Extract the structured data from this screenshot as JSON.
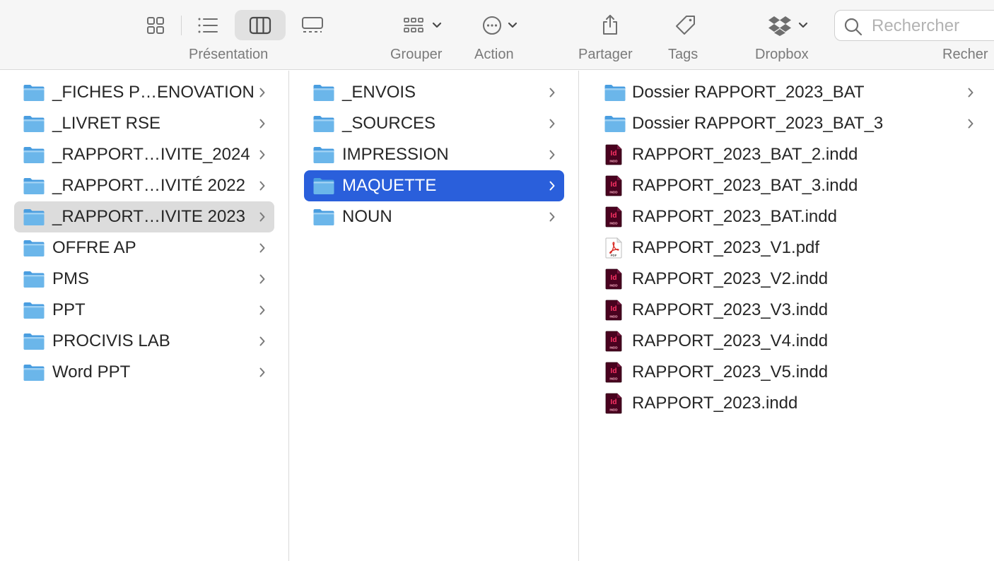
{
  "toolbar": {
    "labels": {
      "presentation": "Présentation",
      "group": "Grouper",
      "action": "Action",
      "share": "Partager",
      "tags": "Tags",
      "dropbox": "Dropbox",
      "search": "Recher"
    },
    "active_view": "columns",
    "search_placeholder": "Rechercher"
  },
  "colors": {
    "folder_blue": "#6bb6ea",
    "selection_blue": "#2a5fdb",
    "selection_gray": "#dcdcdc",
    "indesign_red": "#ff3366",
    "pdf_red": "#d8261f"
  },
  "column1": [
    {
      "name": "_FICHES P…ENOVATION",
      "icon": "folder-icon",
      "selected": false
    },
    {
      "name": "_LIVRET RSE",
      "icon": "folder-icon",
      "selected": false
    },
    {
      "name": "_RAPPORT…IVITE_2024",
      "icon": "folder-icon",
      "selected": false
    },
    {
      "name": "_RAPPORT…IVITÉ 2022",
      "icon": "folder-icon",
      "selected": false
    },
    {
      "name": "_RAPPORT…IVITE 2023",
      "icon": "folder-icon",
      "selected": true
    },
    {
      "name": "OFFRE AP",
      "icon": "folder-icon",
      "selected": false
    },
    {
      "name": "PMS",
      "icon": "folder-icon",
      "selected": false
    },
    {
      "name": "PPT",
      "icon": "folder-icon",
      "selected": false
    },
    {
      "name": "PROCIVIS LAB",
      "icon": "folder-icon",
      "selected": false
    },
    {
      "name": "Word PPT",
      "icon": "folder-icon",
      "selected": false
    }
  ],
  "column2": [
    {
      "name": "_ENVOIS",
      "icon": "folder-icon",
      "selected": false
    },
    {
      "name": "_SOURCES",
      "icon": "folder-icon",
      "selected": false
    },
    {
      "name": "IMPRESSION",
      "icon": "folder-icon",
      "selected": false
    },
    {
      "name": "MAQUETTE",
      "icon": "folder-icon",
      "selected": true
    },
    {
      "name": "NOUN",
      "icon": "folder-icon",
      "selected": false
    }
  ],
  "column3": [
    {
      "name": "Dossier RAPPORT_2023_BAT",
      "icon": "folder-icon"
    },
    {
      "name": "Dossier RAPPORT_2023_BAT_3",
      "icon": "folder-icon"
    },
    {
      "name": "RAPPORT_2023_BAT_2.indd",
      "icon": "indesign-file-icon"
    },
    {
      "name": "RAPPORT_2023_BAT_3.indd",
      "icon": "indesign-file-icon"
    },
    {
      "name": "RAPPORT_2023_BAT.indd",
      "icon": "indesign-file-icon"
    },
    {
      "name": "RAPPORT_2023_V1.pdf",
      "icon": "pdf-file-icon"
    },
    {
      "name": "RAPPORT_2023_V2.indd",
      "icon": "indesign-file-icon"
    },
    {
      "name": "RAPPORT_2023_V3.indd",
      "icon": "indesign-file-icon"
    },
    {
      "name": "RAPPORT_2023_V4.indd",
      "icon": "indesign-file-icon"
    },
    {
      "name": "RAPPORT_2023_V5.indd",
      "icon": "indesign-file-icon"
    },
    {
      "name": "RAPPORT_2023.indd",
      "icon": "indesign-file-icon"
    }
  ],
  "file_badges": {
    "indesign_letters": "Id",
    "indesign_tag": "INDD",
    "pdf_tag": "PDF"
  }
}
